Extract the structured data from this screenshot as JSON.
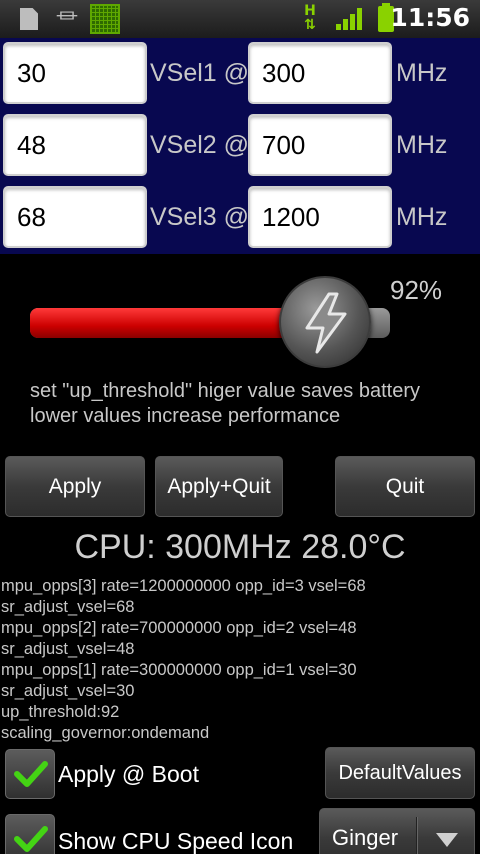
{
  "status_bar": {
    "icons": [
      "sd-card-icon",
      "usb-icon",
      "chip-icon",
      "h-network-icon",
      "signal-icon",
      "battery-icon"
    ],
    "time": "11:56"
  },
  "voltage_rows": [
    {
      "mv": "30",
      "label": "VSel1 @",
      "mhz": "300",
      "unit": "MHz"
    },
    {
      "mv": "48",
      "label": "VSel2 @",
      "mhz": "700",
      "unit": "MHz"
    },
    {
      "mv": "68",
      "label": "VSel3 @",
      "mhz": "1200",
      "unit": "MHz"
    }
  ],
  "slider": {
    "percent_label": "92%",
    "value_fraction": 0.92
  },
  "hint": {
    "line1": "set \"up_threshold\" higer value saves battery",
    "line2": "lower values increase performance"
  },
  "buttons": {
    "apply": "Apply",
    "apply_quit": "Apply+Quit",
    "quit": "Quit"
  },
  "cpu_status": "CPU: 300MHz 28.0°C",
  "log_lines": [
    "mpu_opps[3] rate=1200000000 opp_id=3 vsel=68",
    "sr_adjust_vsel=68",
    "mpu_opps[2] rate=700000000 opp_id=2 vsel=48",
    "sr_adjust_vsel=48",
    "mpu_opps[1] rate=300000000 opp_id=1 vsel=30",
    "sr_adjust_vsel=30",
    "up_threshold:92",
    "scaling_governor:ondemand"
  ],
  "options": {
    "apply_at_boot": {
      "label": "Apply @ Boot",
      "checked": true
    },
    "show_cpu_icon": {
      "label": "Show CPU Speed Icon",
      "checked": true
    }
  },
  "default_values_button": "DefaultValues",
  "profile_spinner": {
    "selected": "Ginger"
  },
  "colors": {
    "panel_bg": "#080850",
    "slider_fill": "#cc0000",
    "status_green": "#8ad200",
    "check_green": "#44d414"
  }
}
